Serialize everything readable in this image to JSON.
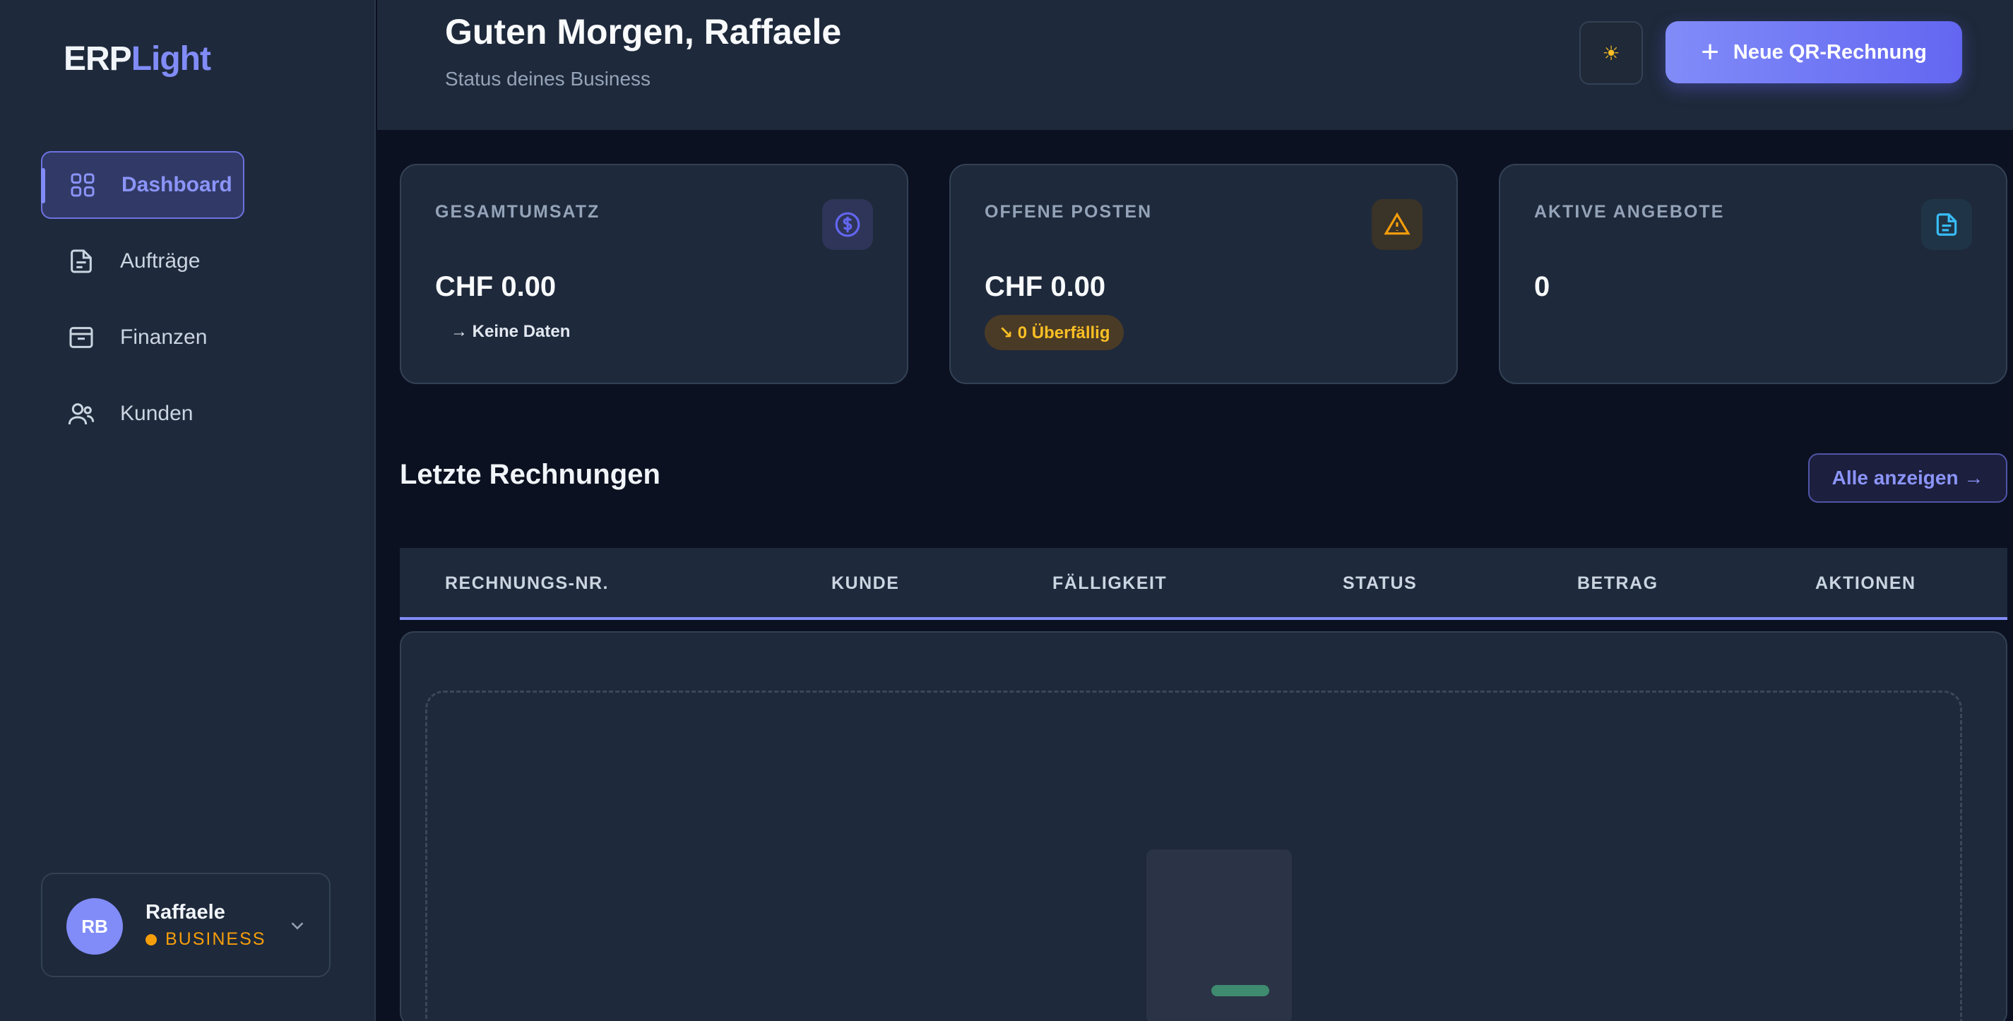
{
  "sidebar": {
    "logo_main": "ERP",
    "logo_accent": "Light",
    "items": [
      {
        "label": "Dashboard",
        "icon": "grid-icon",
        "active": true
      },
      {
        "label": "Aufträge",
        "icon": "document-icon",
        "active": false
      },
      {
        "label": "Finanzen",
        "icon": "wallet-icon",
        "active": false
      },
      {
        "label": "Kunden",
        "icon": "users-icon",
        "active": false
      }
    ],
    "user": {
      "initials": "RB",
      "name": "Raffaele",
      "plan": "BUSINESS"
    }
  },
  "header": {
    "greeting": "Guten Morgen, Raffaele",
    "subtitle": "Status deines Business",
    "theme_icon": "☀",
    "primary_button": "Neue QR-Rechnung"
  },
  "stats": [
    {
      "label": "GESAMTUMSATZ",
      "value": "CHF 0.00",
      "note": "→ Keine Daten",
      "icon": "dollar-icon"
    },
    {
      "label": "OFFENE POSTEN",
      "value": "CHF 0.00",
      "badge": "↘ 0 Überfällig",
      "icon": "warning-icon"
    },
    {
      "label": "AKTIVE ANGEBOTE",
      "value": "0",
      "icon": "file-text-icon"
    }
  ],
  "invoices": {
    "title": "Letzte Rechnungen",
    "view_all": "Alle anzeigen →",
    "columns": [
      "RECHNUNGS-NR.",
      "KUNDE",
      "FÄLLIGKEIT",
      "STATUS",
      "BETRAG",
      "AKTIONEN"
    ]
  },
  "colors": {
    "accent": "#818cf8",
    "warning": "#f59e0b",
    "success": "#3f8b6f"
  }
}
